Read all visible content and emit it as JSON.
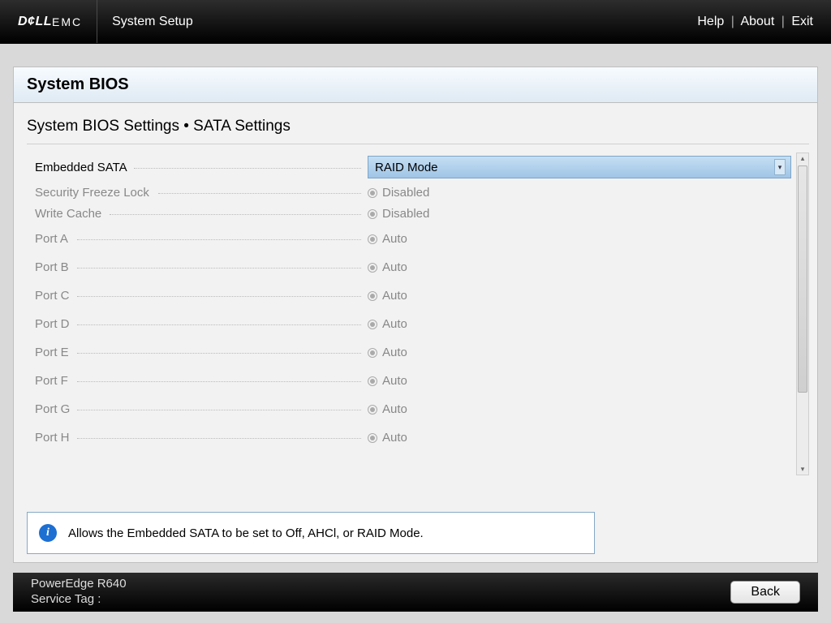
{
  "header": {
    "brand_main": "D¢LL",
    "brand_emc": "EMC",
    "app_title": "System Setup",
    "links": {
      "help": "Help",
      "about": "About",
      "exit": "Exit"
    }
  },
  "panel": {
    "title": "System BIOS",
    "breadcrumb": "System BIOS Settings • SATA Settings"
  },
  "settings": {
    "embedded_sata": {
      "label": "Embedded SATA",
      "value": "RAID Mode"
    },
    "security_freeze": {
      "label": "Security Freeze Lock",
      "value": "Disabled"
    },
    "write_cache": {
      "label": "Write Cache",
      "value": "Disabled"
    },
    "ports": [
      {
        "label": "Port A",
        "value": "Auto"
      },
      {
        "label": "Port B",
        "value": "Auto"
      },
      {
        "label": "Port C",
        "value": "Auto"
      },
      {
        "label": "Port D",
        "value": "Auto"
      },
      {
        "label": "Port E",
        "value": "Auto"
      },
      {
        "label": "Port F",
        "value": "Auto"
      },
      {
        "label": "Port G",
        "value": "Auto"
      },
      {
        "label": "Port H",
        "value": "Auto"
      }
    ]
  },
  "info_text": "Allows the Embedded SATA to be set to Off, AHCl, or RAID Mode.",
  "footer": {
    "model": "PowerEdge R640",
    "service_tag_label": "Service Tag :",
    "back": "Back"
  }
}
